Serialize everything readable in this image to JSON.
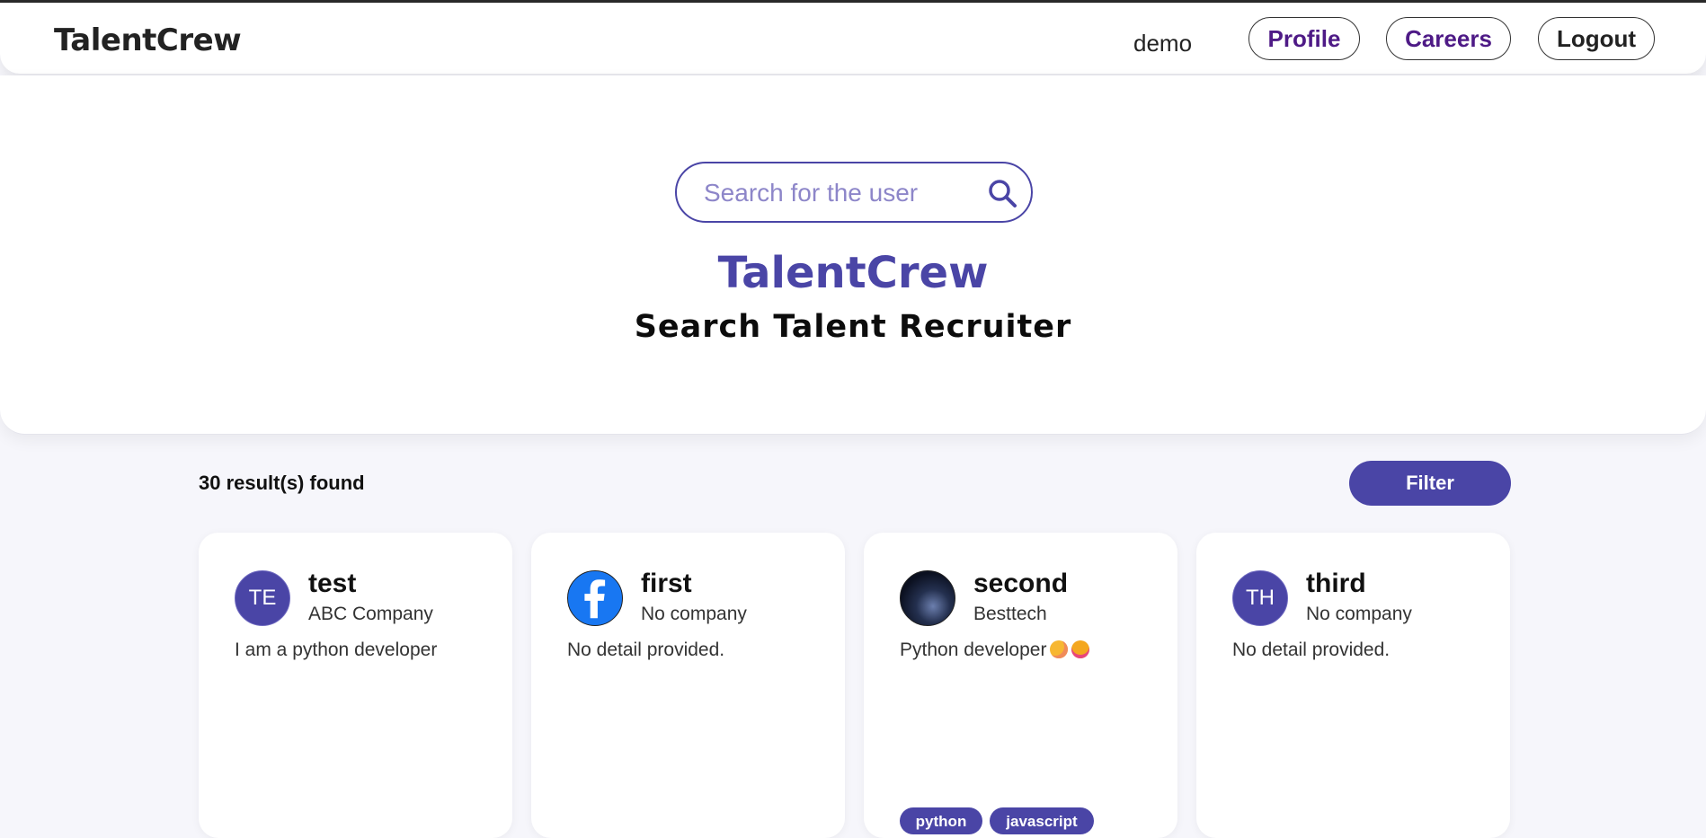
{
  "navbar": {
    "brand": "TalentCrew",
    "username": "demo",
    "links": [
      "Profile",
      "Careers",
      "Logout"
    ]
  },
  "hero": {
    "search_placeholder": "Search for the user",
    "title": "TalentCrew",
    "subtitle": "Search Talent Recruiter"
  },
  "results": {
    "count_text": "30 result(s) found",
    "filter_label": "Filter"
  },
  "cards": [
    {
      "initials": "TE",
      "name": "test",
      "company": "ABC Company",
      "detail": "I am a python developer",
      "avatar": "initials"
    },
    {
      "initials": "",
      "name": "first",
      "company": "No company",
      "detail": "No detail provided.",
      "avatar": "facebook-icon"
    },
    {
      "initials": "",
      "name": "second",
      "company": "Besttech",
      "detail": "Python developer",
      "avatar": "photo",
      "emojis": [
        "sleepy-face-emoji",
        "heart-eyes-emoji"
      ],
      "tags": [
        "python",
        "javascript"
      ]
    },
    {
      "initials": "TH",
      "name": "third",
      "company": "No company",
      "detail": "No detail provided.",
      "avatar": "initials"
    }
  ],
  "colors": {
    "accent": "#4a45a6",
    "nav_link": "#4e1a86",
    "facebook": "#1877f2"
  }
}
